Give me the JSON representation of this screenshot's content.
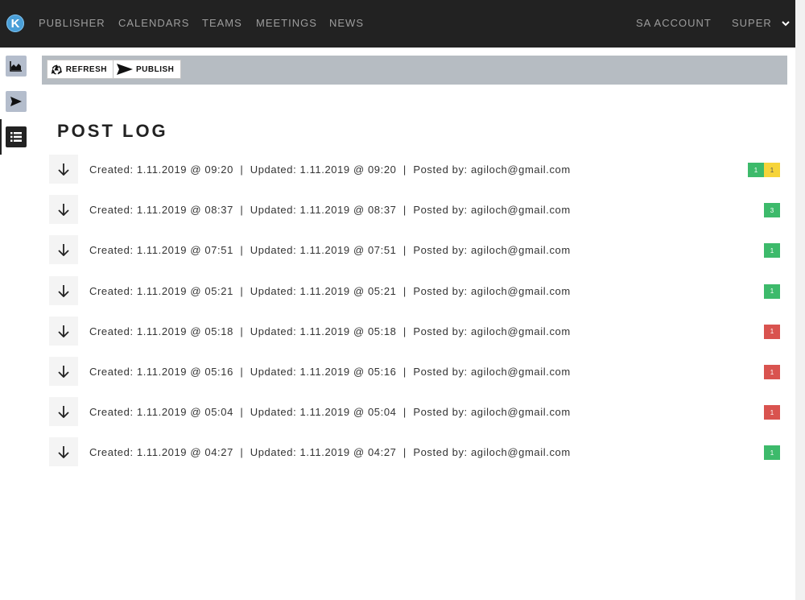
{
  "nav": {
    "logo": "K",
    "links": [
      "PUBLISHER",
      "CALENDARS",
      "TEAMS",
      "MEETINGS",
      "NEWS"
    ],
    "account": "SA ACCOUNT",
    "user": "SUPER"
  },
  "sidebar": {
    "items": [
      {
        "icon": "area-chart-icon"
      },
      {
        "icon": "send-icon"
      },
      {
        "icon": "list-icon",
        "active": true
      }
    ]
  },
  "toolbar": {
    "refresh_label": "REFRESH",
    "publish_label": "PUBLISH"
  },
  "page": {
    "title": "POST LOG"
  },
  "colors": {
    "green": "#3dba6b",
    "yellow": "#f6d43a",
    "red": "#d9534f",
    "nav": "#222222"
  },
  "log": [
    {
      "text": "Created: 1.11.2019 @ 09:20  |  Updated: 1.11.2019 @ 09:20  |  Posted by: agiloch@gmail.com",
      "badges": [
        {
          "value": "1",
          "color": "green"
        },
        {
          "value": "1",
          "color": "yellow"
        }
      ]
    },
    {
      "text": "Created: 1.11.2019 @ 08:37  |  Updated: 1.11.2019 @ 08:37  |  Posted by: agiloch@gmail.com",
      "badges": [
        {
          "value": "3",
          "color": "green"
        }
      ]
    },
    {
      "text": "Created: 1.11.2019 @ 07:51  |  Updated: 1.11.2019 @ 07:51  |  Posted by: agiloch@gmail.com",
      "badges": [
        {
          "value": "1",
          "color": "green"
        }
      ]
    },
    {
      "text": "Created: 1.11.2019 @ 05:21  |  Updated: 1.11.2019 @ 05:21  |  Posted by: agiloch@gmail.com",
      "badges": [
        {
          "value": "1",
          "color": "green"
        }
      ]
    },
    {
      "text": "Created: 1.11.2019 @ 05:18  |  Updated: 1.11.2019 @ 05:18  |  Posted by: agiloch@gmail.com",
      "badges": [
        {
          "value": "1",
          "color": "red"
        }
      ]
    },
    {
      "text": "Created: 1.11.2019 @ 05:16  |  Updated: 1.11.2019 @ 05:16  |  Posted by: agiloch@gmail.com",
      "badges": [
        {
          "value": "1",
          "color": "red"
        }
      ]
    },
    {
      "text": "Created: 1.11.2019 @ 05:04  |  Updated: 1.11.2019 @ 05:04  |  Posted by: agiloch@gmail.com",
      "badges": [
        {
          "value": "1",
          "color": "red"
        }
      ]
    },
    {
      "text": "Created: 1.11.2019 @ 04:27  |  Updated: 1.11.2019 @ 04:27  |  Posted by: agiloch@gmail.com",
      "badges": [
        {
          "value": "1",
          "color": "green"
        }
      ]
    }
  ]
}
